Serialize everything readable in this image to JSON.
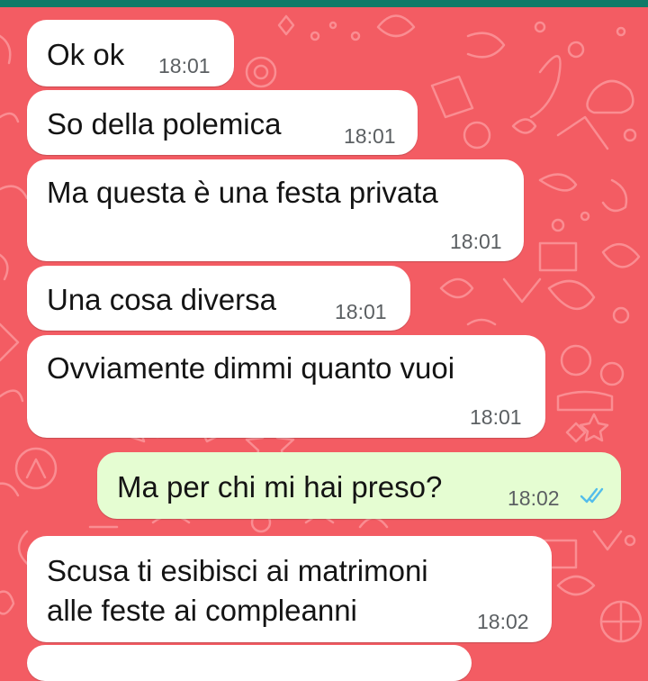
{
  "chat": {
    "messages": [
      {
        "text": "Ok ok",
        "time": "18:01",
        "direction": "incoming"
      },
      {
        "text": "So della polemica",
        "time": "18:01",
        "direction": "incoming"
      },
      {
        "text": "Ma questa è una festa privata",
        "time": "18:01",
        "direction": "incoming"
      },
      {
        "text": "Una cosa diversa",
        "time": "18:01",
        "direction": "incoming"
      },
      {
        "text": "Ovviamente dimmi quanto vuoi",
        "time": "18:01",
        "direction": "incoming"
      },
      {
        "text": "Ma per chi mi hai preso?",
        "time": "18:02",
        "direction": "outgoing",
        "status": "read"
      },
      {
        "text_line1": "Scusa ti esibisci ai matrimoni",
        "text_line2": "alle feste ai compleanni",
        "time": "18:02",
        "direction": "incoming"
      }
    ]
  },
  "colors": {
    "wallpaper": "#f35c63",
    "header": "#0f7a68",
    "incoming_bubble": "#ffffff",
    "outgoing_bubble": "#e5fdd2",
    "read_ticks": "#53bdeb"
  },
  "icons": {
    "read_receipt": "double-check-icon"
  }
}
